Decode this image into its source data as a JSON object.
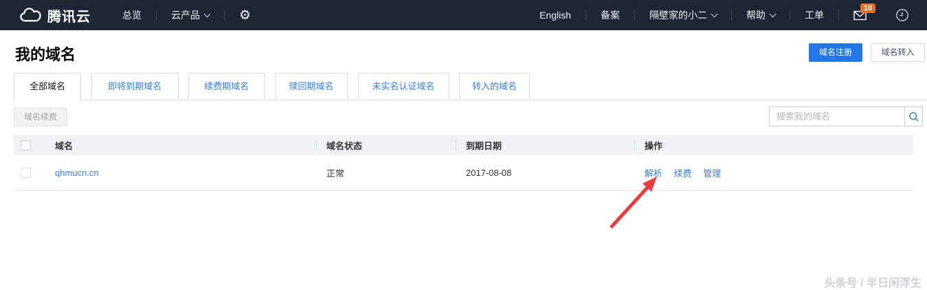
{
  "navbar": {
    "brand": "腾讯云",
    "overview": "总览",
    "products": "云产品",
    "english": "English",
    "beian": "备案",
    "account": "隔壁家的小二",
    "help": "帮助",
    "ticket": "工单",
    "message_count": "10"
  },
  "page": {
    "title": "我的域名",
    "register_button": "域名注册",
    "transfer_button": "域名转入"
  },
  "tabs": [
    {
      "label": "全部域名",
      "active": true
    },
    {
      "label": "即将到期域名",
      "active": false
    },
    {
      "label": "续费期域名",
      "active": false
    },
    {
      "label": "赎回期域名",
      "active": false
    },
    {
      "label": "未实名认证域名",
      "active": false
    },
    {
      "label": "转入的域名",
      "active": false
    }
  ],
  "toolbar": {
    "renew_button": "域名续费",
    "search_placeholder": "搜索我的域名"
  },
  "table": {
    "headers": [
      "域名",
      "域名状态",
      "到期日期",
      "操作"
    ],
    "rows": [
      {
        "domain": "qhmucn.cn",
        "status": "正常",
        "expiry": "2017-08-08",
        "actions": [
          "解析",
          "续费",
          "管理"
        ]
      }
    ]
  },
  "icons": {
    "logo": "tencent-cloud-logo",
    "settings": "gear",
    "mail": "envelope",
    "history": "clock",
    "search": "magnifier",
    "annotation": "red-arrow"
  },
  "colors": {
    "navbar_bg": "#1e2633",
    "primary_blue": "#2377e4",
    "link_blue": "#3b7dd8",
    "badge_orange": "#e5702b",
    "arrow_red": "#e53e3e",
    "header_bg": "#f1f2f6"
  },
  "watermark": "头条号 / 半日闲浮生"
}
